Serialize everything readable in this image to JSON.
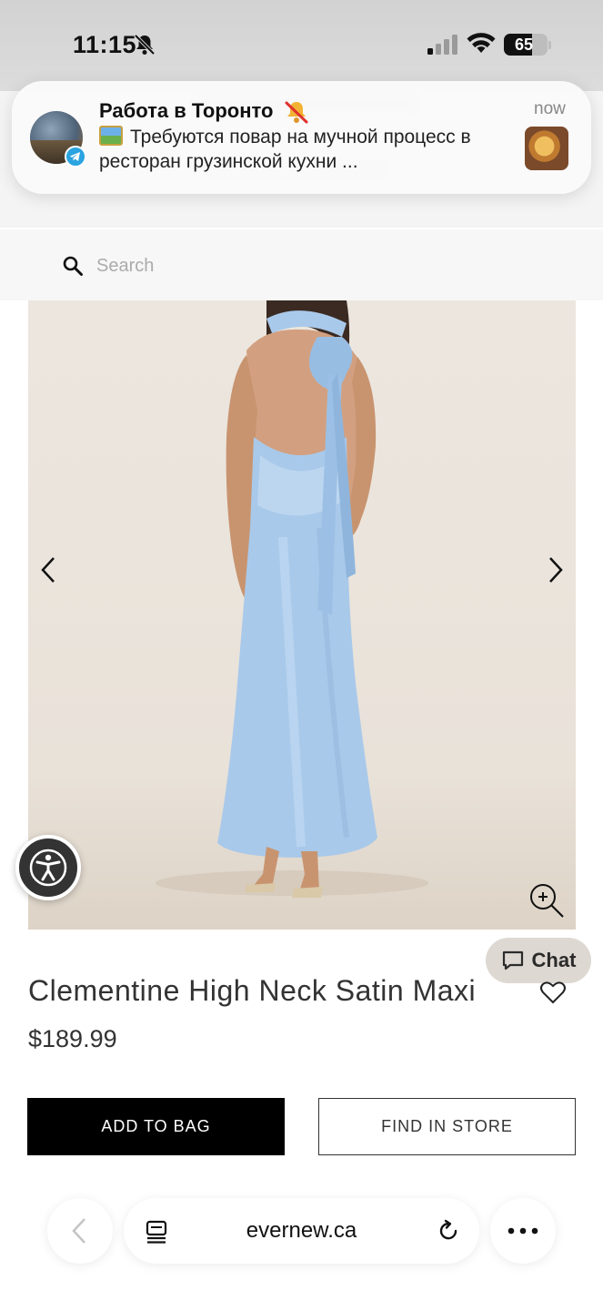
{
  "status_bar": {
    "time": "11:15",
    "battery_percent": "65",
    "battery_level": 0.65,
    "silent_mode": true
  },
  "notification": {
    "title": "Работа в Торонто",
    "time": "now",
    "body": "Требуются повар на мучной процесс в ресторан грузинской кухни ...",
    "app_icon": "telegram-icon"
  },
  "search": {
    "placeholder": "Search"
  },
  "product": {
    "title": "Clementine High Neck Satin Maxi",
    "price": "$189.99",
    "add_to_bag_label": "ADD TO BAG",
    "find_in_store_label": "FIND IN STORE"
  },
  "chat": {
    "label": "Chat"
  },
  "browser": {
    "address": "evernew.ca"
  }
}
